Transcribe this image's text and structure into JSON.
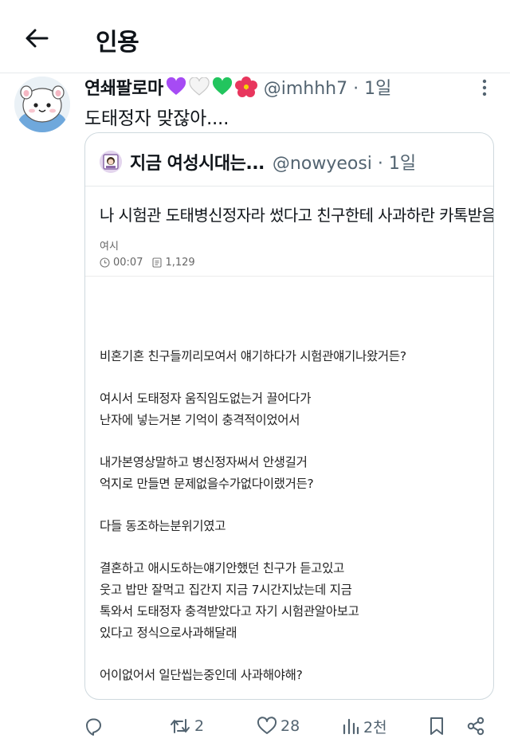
{
  "header": {
    "title": "인용",
    "back_icon": "arrow-left-icon"
  },
  "tweet": {
    "display_name": "연쇄팔로마",
    "name_emojis": [
      "purple-heart",
      "white-heart",
      "green-heart",
      "hibiscus"
    ],
    "handle": "@imhhh7",
    "time": "1일",
    "text": "도태정자 맞잖아....",
    "more_icon": "more-vertical-icon"
  },
  "quote": {
    "display_name": "지금 여성시대는...",
    "handle": "@nowyeosi",
    "time": "1일",
    "article": {
      "title": "나 시험관 도태병신정자라 썼다고 친구한테 사과하란 카톡받음",
      "source": "여시",
      "time": "00:07",
      "views": "1,129",
      "paragraphs": [
        [
          "비혼기혼 친구들끼리모여서 얘기하다가 시험관얘기나왔거든?"
        ],
        [
          "여시서 도태정자 움직임도없는거 끌어다가",
          "난자에 넣는거본 기억이 충격적이었어서"
        ],
        [
          "내가본영상말하고 병신정자써서 안생길거",
          "억지로 만들면 문제없을수가없다이랬거든?"
        ],
        [
          "다들 동조하는분위기였고"
        ],
        [
          "결혼하고 애시도하는얘기안했던 친구가 듣고있고",
          "웃고 밥만 잘먹고 집간지 지금 7시간지났는데 지금",
          "톡와서 도태정자 충격받았다고 자기 시험관알아보고",
          "있다고 정식으로사과해달래"
        ],
        [
          "어이없어서 일단씹는중인데 사과해야해?"
        ]
      ]
    }
  },
  "actions": {
    "reply": {
      "icon": "reply-icon",
      "count": ""
    },
    "retweet": {
      "icon": "retweet-icon",
      "count": "2"
    },
    "like": {
      "icon": "heart-icon",
      "count": "28"
    },
    "views": {
      "icon": "views-icon",
      "count": "2천"
    },
    "bookmark": {
      "icon": "bookmark-icon",
      "count": ""
    },
    "share": {
      "icon": "share-icon",
      "count": ""
    }
  },
  "colors": {
    "text": "#0f1419",
    "secondary": "#536471",
    "border": "#cfd9de",
    "purple": "#a64bf4",
    "green": "#22c55e",
    "hibiscus": "#e8365d"
  }
}
